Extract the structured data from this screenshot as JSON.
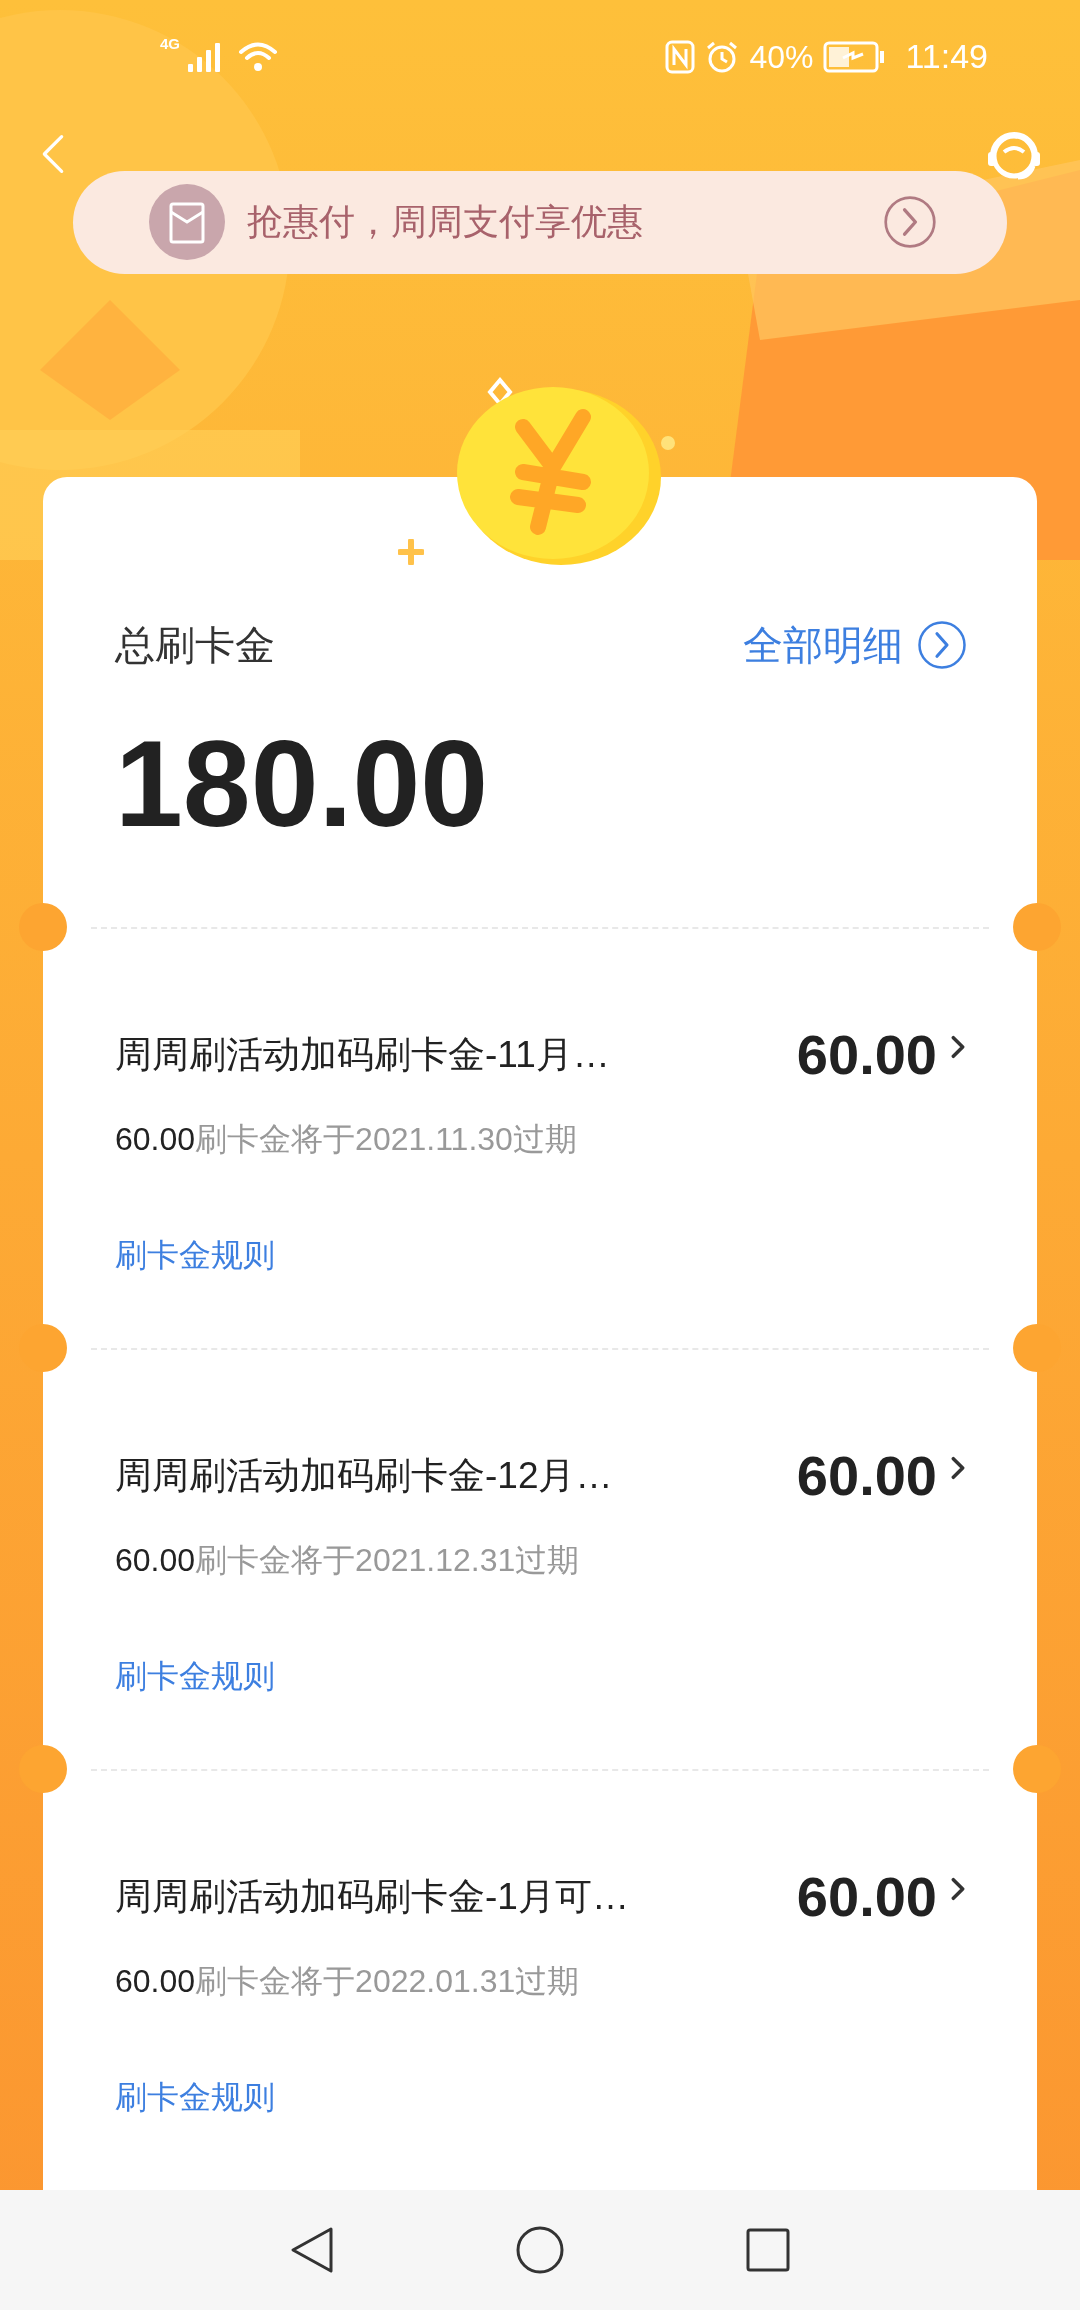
{
  "status_bar": {
    "network": "4G",
    "battery": "40%",
    "time": "11:49"
  },
  "banner": {
    "text": "抢惠付，周周支付享优惠"
  },
  "summary": {
    "label": "总刷卡金",
    "link": "全部明细",
    "amount": "180.00"
  },
  "items": [
    {
      "title": "周周刷活动加码刷卡金-11月…",
      "amount": "60.00",
      "expiry_amount": "60.00",
      "expiry_text": "刷卡金将于2021.11.30过期",
      "rules": "刷卡金规则"
    },
    {
      "title": "周周刷活动加码刷卡金-12月…",
      "amount": "60.00",
      "expiry_amount": "60.00",
      "expiry_text": "刷卡金将于2021.12.31过期",
      "rules": "刷卡金规则"
    },
    {
      "title": "周周刷活动加码刷卡金-1月可…",
      "amount": "60.00",
      "expiry_amount": "60.00",
      "expiry_text": "刷卡金将于2022.01.31过期",
      "rules": "刷卡金规则"
    }
  ]
}
